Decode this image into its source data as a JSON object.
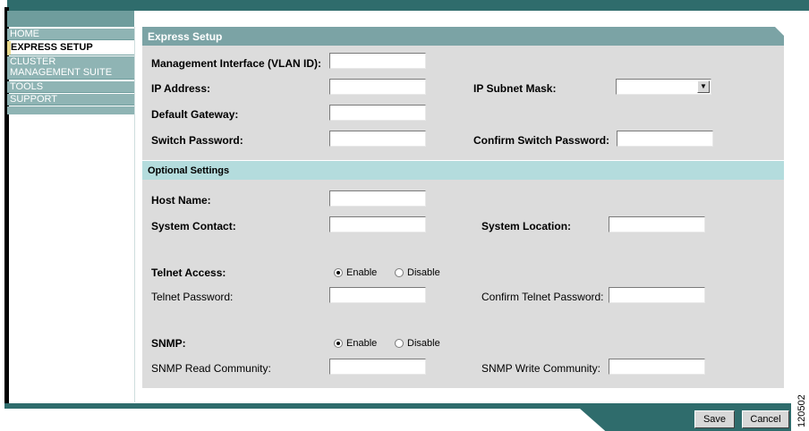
{
  "colors": {
    "frame": "#2f6c6c",
    "nav_bg": "#8fb4b4",
    "panel_header": "#7ba3a5",
    "optional_header": "#b4dcdd",
    "panel_bg": "#dcdcdc"
  },
  "sidebar": {
    "items": [
      {
        "label": "HOME",
        "active": false
      },
      {
        "label": "EXPRESS SETUP",
        "active": true
      },
      {
        "label": "CLUSTER",
        "active": false
      },
      {
        "label": "MANAGEMENT SUITE",
        "active": false
      },
      {
        "label": "TOOLS",
        "active": false
      },
      {
        "label": "SUPPORT",
        "active": false
      }
    ]
  },
  "panel": {
    "title": "Express Setup",
    "management_interface": {
      "label": "Management Interface (VLAN ID):",
      "value": ""
    },
    "ip_address": {
      "label": "IP Address:",
      "value": ""
    },
    "ip_subnet_mask": {
      "label": "IP Subnet Mask:",
      "selected": ""
    },
    "default_gateway": {
      "label": "Default Gateway:",
      "value": ""
    },
    "switch_password": {
      "label": "Switch Password:",
      "value": ""
    },
    "confirm_switch_password": {
      "label": "Confirm Switch Password:",
      "value": ""
    }
  },
  "optional": {
    "title": "Optional Settings",
    "host_name": {
      "label": "Host Name:",
      "value": ""
    },
    "system_contact": {
      "label": "System Contact:",
      "value": ""
    },
    "system_location": {
      "label": "System Location:",
      "value": ""
    },
    "telnet_access": {
      "label": "Telnet Access:",
      "enable": "Enable",
      "disable": "Disable",
      "selected": "Enable"
    },
    "telnet_password": {
      "label": "Telnet Password:",
      "value": ""
    },
    "confirm_telnet_password": {
      "label": "Confirm Telnet Password:",
      "value": ""
    },
    "snmp": {
      "label": "SNMP:",
      "enable": "Enable",
      "disable": "Disable",
      "selected": "Enable"
    },
    "snmp_read_community": {
      "label": "SNMP Read Community:",
      "value": ""
    },
    "snmp_write_community": {
      "label": "SNMP Write Community:",
      "value": ""
    }
  },
  "footer": {
    "save_label": "Save",
    "cancel_label": "Cancel",
    "figure_number": "120502"
  }
}
